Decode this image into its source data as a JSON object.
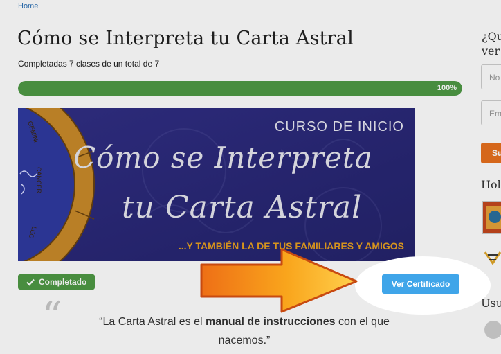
{
  "breadcrumb": {
    "home": "Home"
  },
  "course": {
    "title": "Cómo se Interpreta tu Carta Astral",
    "progress_text": "Completadas 7 clases de un total de 7",
    "progress_percent": 100,
    "progress_label": "100%",
    "status_badge": "Completado",
    "certificate_button": "Ver Certificado"
  },
  "banner": {
    "kicker": "CURSO DE INICIO",
    "title_line1": "Cómo se Interpreta",
    "title_line2": "tu Carta Astral",
    "subtitle": "...Y TAMBIÉN LA DE TUS FAMILIARES Y AMIGOS",
    "zodiac_signs": [
      "GEMINI",
      "CANCER",
      "LEO"
    ]
  },
  "quote": {
    "mark": "“",
    "text_before": "“La Carta Astral es el ",
    "text_bold": "manual de instrucciones",
    "text_after": " con el que nacemos.”"
  },
  "sidebar": {
    "heading_line1": "¿Qu",
    "heading_line2": "ver",
    "name_placeholder": "No",
    "email_placeholder": "Em",
    "submit_label": "Su",
    "section_hol": "Hol",
    "section_usu": "Usu"
  },
  "colors": {
    "progress": "#4f9a45",
    "banner_bg": "#2b2a7a",
    "banner_gold": "#e8a020",
    "cert_button": "#3fa5e9",
    "sidebar_button": "#e8701e",
    "arrow_orange": "#f5a623"
  },
  "icons": {
    "check": "check-icon",
    "quote": "quote-icon",
    "arrow": "arrow-icon"
  }
}
